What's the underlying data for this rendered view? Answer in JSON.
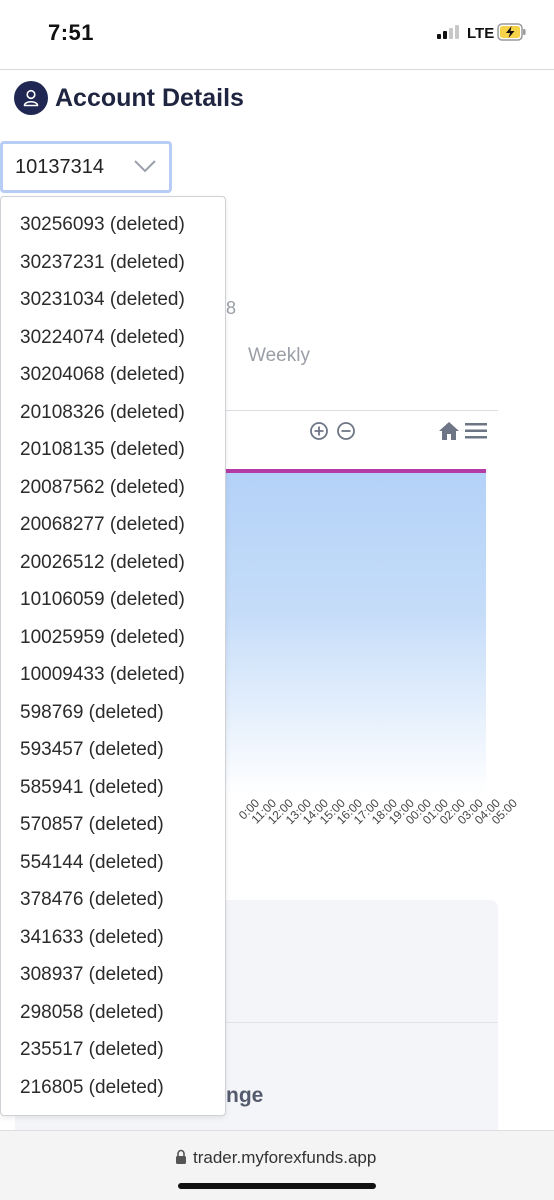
{
  "status_bar": {
    "time": "7:51",
    "network": "LTE"
  },
  "header": {
    "title": "Account Details"
  },
  "account_select": {
    "value": "10137314"
  },
  "dropdown": {
    "options": [
      "30256093 (deleted)",
      "30237231 (deleted)",
      "30231034 (deleted)",
      "30224074 (deleted)",
      "30204068 (deleted)",
      "20108326 (deleted)",
      "20108135 (deleted)",
      "20087562 (deleted)",
      "20068277 (deleted)",
      "20026512 (deleted)",
      "10106059 (deleted)",
      "10025959 (deleted)",
      "10009433 (deleted)",
      "598769 (deleted)",
      "593457 (deleted)",
      "585941 (deleted)",
      "570857 (deleted)",
      "554144 (deleted)",
      "378476 (deleted)",
      "341633 (deleted)",
      "308937 (deleted)",
      "298058 (deleted)",
      "235517 (deleted)",
      "216805 (deleted)"
    ]
  },
  "background": {
    "partial_digit": "8",
    "tab_weekly": "Weekly",
    "card_partial_text": "nge",
    "x_axis_labels": [
      "0:00",
      "11:00",
      "12:00",
      "13:00",
      "14:00",
      "15:00",
      "16:00",
      "17:00",
      "18:00",
      "19:00",
      "00:00",
      "01:00",
      "02:00",
      "03:00",
      "04:00",
      "05:00"
    ]
  },
  "colors": {
    "accent": "#1f2752",
    "series_line": "#b43aa6",
    "area_fill": "#b3d1f8",
    "select_border": "#b8cdf5"
  },
  "url_bar": {
    "url": "trader.myforexfunds.app"
  }
}
